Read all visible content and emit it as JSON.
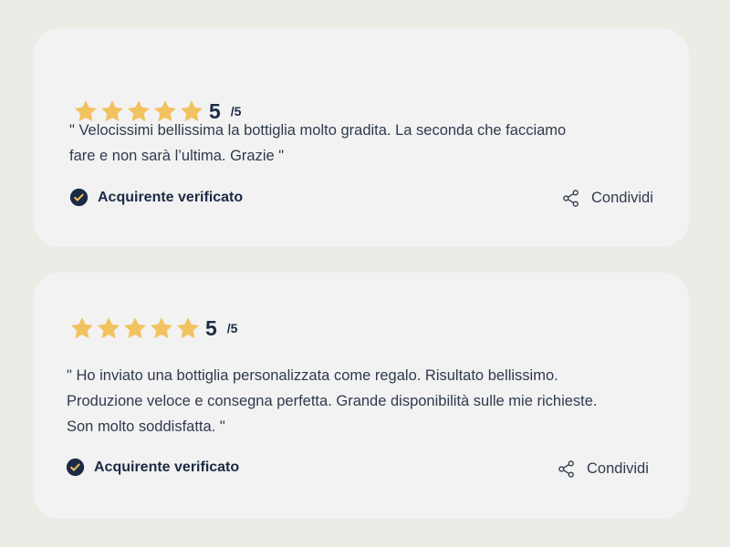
{
  "colors": {
    "page_background": "#edebe6",
    "card_background": "#f2f2f2",
    "star": "#f2c260",
    "heading_text": "#1c2b45",
    "body_text": "#2f3a4d",
    "check_badge": "#1c2b45"
  },
  "icons": {
    "star": "star-icon",
    "verified": "check-circle-icon",
    "share": "share-icon"
  },
  "reviews": [
    {
      "stars": 5,
      "score": "5",
      "scale": "/5",
      "text": "\" Velocissimi bellissima la bottiglia molto gradita. La seconda che facciamo\nfare e non sarà l’ultima. Grazie \"",
      "verified_label": "Acquirente verificato",
      "share_label": "Condividi"
    },
    {
      "stars": 5,
      "score": "5",
      "scale": "/5",
      "text": "\" Ho inviato una bottiglia personalizzata come regalo. Risultato bellissimo.\nProduzione veloce e consegna perfetta. Grande disponibilità sulle mie richieste.\nSon molto soddisfatta. \"",
      "verified_label": "Acquirente verificato",
      "share_label": "Condividi"
    }
  ]
}
